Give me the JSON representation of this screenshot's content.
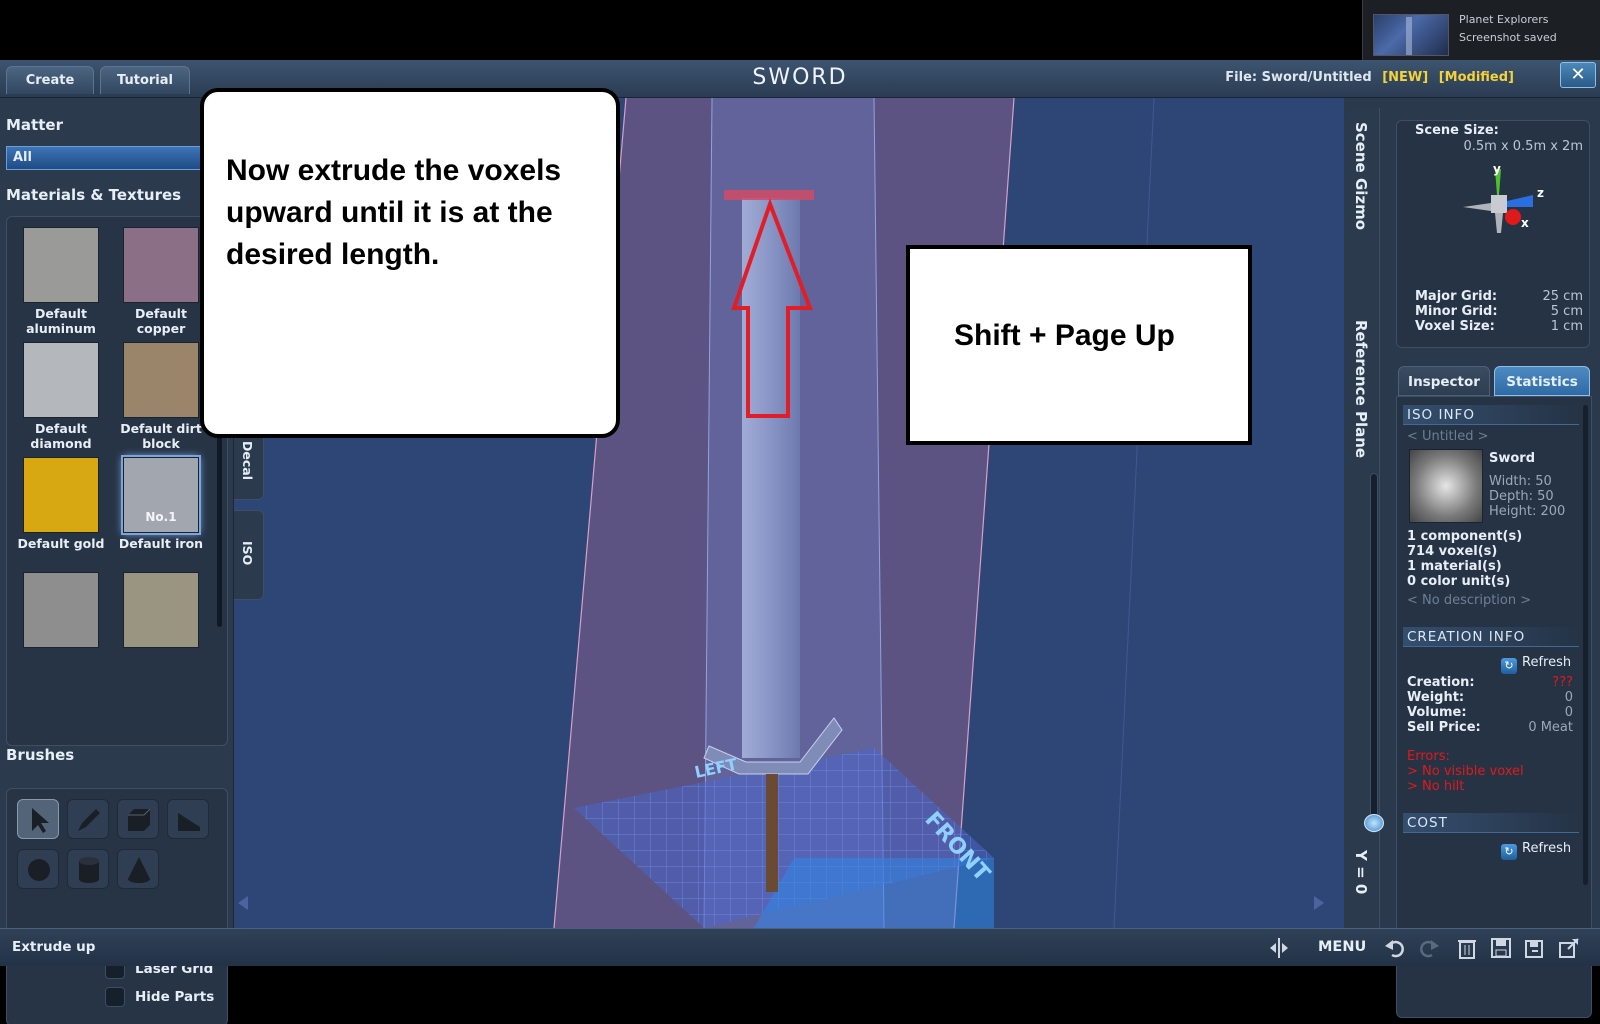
{
  "notification": {
    "app": "Planet Explorers",
    "message": "Screenshot saved"
  },
  "topbar": {
    "create_label": "Create",
    "tutorial_label": "Tutorial",
    "title": "SWORD",
    "file_label": "File:",
    "file_path": "Sword/Untitled",
    "tag_new": "[NEW]",
    "tag_modified": "[Modified]",
    "close_label": "✕"
  },
  "left": {
    "matter_title": "Matter",
    "matter_value": "All",
    "materials_title": "Materials & Textures",
    "materials": [
      {
        "label1": "Default",
        "label2": "aluminum",
        "color": "#9a9a98"
      },
      {
        "label1": "Default",
        "label2": "copper",
        "color": "#8a6f86"
      },
      {
        "label1": "Default",
        "label2": "diamond",
        "color": "#b4b8bc"
      },
      {
        "label1": "Default dirt",
        "label2": "block",
        "color": "#9a856a"
      },
      {
        "label1": "Default gold",
        "label2": "",
        "color": "#d8a812"
      },
      {
        "label1": "Default iron",
        "label2": "",
        "color": "#a2a6ae",
        "number": "No.1"
      },
      {
        "label1": "",
        "label2": "",
        "color": "#8e8e8e"
      },
      {
        "label1": "",
        "label2": "",
        "color": "#9a9580"
      }
    ],
    "brushes_title": "Brushes",
    "laser_grid_label": "Laser Grid",
    "hide_parts_label": "Hide Parts",
    "side_tabs": {
      "decal": "Decal",
      "iso": "ISO"
    }
  },
  "callouts": {
    "instruction": "Now extrude the voxels upward until it is at the desired length.",
    "shortcut": "Shift + Page Up"
  },
  "viewport": {
    "left_label": "LEFT",
    "front_label": "FRONT"
  },
  "right": {
    "scene_gizmo_label": "Scene Gizmo",
    "reference_plane_label": "Reference Plane",
    "y_label": "Y = 0",
    "scene_size_label": "Scene Size:",
    "scene_size_value": "0.5m x 0.5m x 2m",
    "axis_y": "y",
    "axis_z": "z",
    "axis_x": "x",
    "major_grid_label": "Major Grid:",
    "major_grid_value": "25 cm",
    "minor_grid_label": "Minor Grid:",
    "minor_grid_value": "5 cm",
    "voxel_size_label": "Voxel Size:",
    "voxel_size_value": "1 cm",
    "tab_inspector": "Inspector",
    "tab_statistics": "Statistics",
    "iso_info_header": "ISO INFO",
    "iso_name_placeholder": "< Untitled >",
    "iso_type": "Sword",
    "width": "Width: 50",
    "depth": "Depth: 50",
    "height": "Height: 200",
    "components": "1 component(s)",
    "voxels": "714 voxel(s)",
    "materials": "1 material(s)",
    "color_units": "0 color unit(s)",
    "no_description": "< No description >",
    "creation_info_header": "CREATION INFO",
    "refresh_label": "Refresh",
    "creation_label": "Creation:",
    "creation_value": "???",
    "weight_label": "Weight:",
    "weight_value": "0",
    "volume_label": "Volume:",
    "volume_value": "0",
    "sell_price_label": "Sell Price:",
    "sell_price_value": "0 Meat",
    "errors_label": "Errors:",
    "error1": "> No visible voxel",
    "error2": "> No hilt",
    "cost_header": "COST"
  },
  "bottombar": {
    "status": "Extrude up",
    "menu_label": "MENU"
  }
}
